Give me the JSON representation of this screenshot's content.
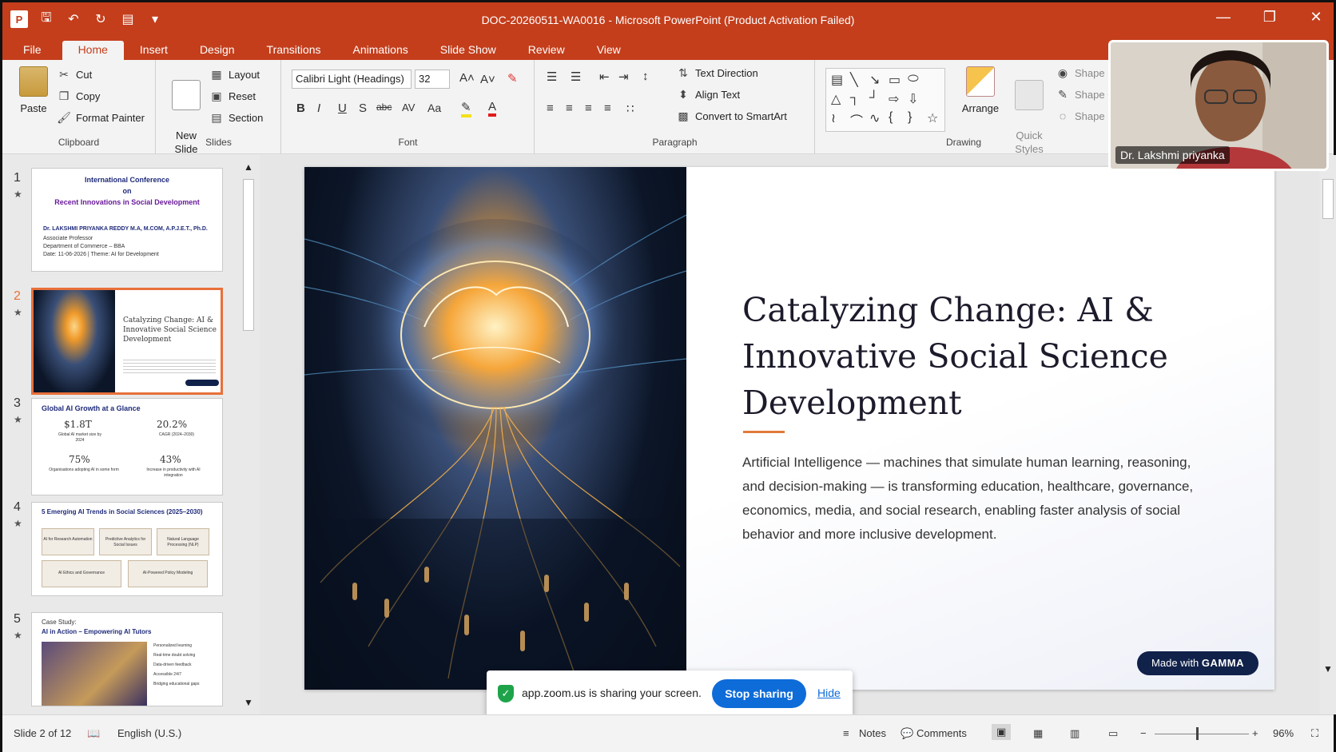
{
  "window": {
    "title": "DOC-20260511-WA0016  -  Microsoft PowerPoint (Product Activation Failed)",
    "app_logo": "P"
  },
  "tabs": [
    "File",
    "Home",
    "Insert",
    "Design",
    "Transitions",
    "Animations",
    "Slide Show",
    "Review",
    "View"
  ],
  "ribbon": {
    "clipboard": {
      "paste": "Paste",
      "cut": "Cut",
      "copy": "Copy",
      "format_painter": "Format Painter",
      "label": "Clipboard"
    },
    "slides": {
      "new_slide": "New\nSlide",
      "layout": "Layout",
      "reset": "Reset",
      "section": "Section",
      "label": "Slides"
    },
    "font": {
      "family": "Calibri Light (Headings)",
      "size": "32",
      "label": "Font"
    },
    "paragraph": {
      "text_direction": "Text Direction",
      "align_text": "Align Text",
      "convert_smartart": "Convert to SmartArt",
      "label": "Paragraph"
    },
    "drawing": {
      "arrange": "Arrange",
      "quick_styles": "Quick\nStyles",
      "shape_fill": "Shape Fill",
      "shape_outline": "Shape Out",
      "shape_effects": "Shape Effe",
      "label": "Drawing"
    }
  },
  "thumbnails": [
    {
      "num": "1",
      "lines": [
        "International Conference",
        "on",
        "Recent Innovations in Social Development",
        "Dr. LAKSHMI PRIYANKA REDDY M.A, M.COM, A.P.J.E.T., Ph.D.",
        "Associate Professor",
        "Department of Commerce – BBA",
        "Date: 11-06-2026  |  Theme: AI for Development"
      ]
    },
    {
      "num": "2",
      "lines": [
        "Catalyzing Change: AI & Innovative Social Science Development"
      ]
    },
    {
      "num": "3",
      "lines": [
        "Global AI Growth at a Glance",
        "$1.8T",
        "Global AI market size by 2024",
        "20.2%",
        "CAGR (2024–2030)",
        "75%",
        "Organisations adopting AI in some form",
        "43%",
        "Increase in productivity with AI integration"
      ]
    },
    {
      "num": "4",
      "lines": [
        "5 Emerging AI Trends in Social Sciences (2025–2030)",
        "AI for Research Automation",
        "Predictive Analytics for Social Issues",
        "Natural Language Processing (NLP)",
        "AI Ethics and Governance",
        "AI-Powered Policy Modeling"
      ]
    },
    {
      "num": "5",
      "lines": [
        "Case Study:",
        "AI in Action – Empowering AI Tutors",
        "Personalized learning",
        "Real-time doubt solving",
        "Data-driven feedback",
        "Accessible 24/7",
        "Bridging educational gaps"
      ]
    }
  ],
  "slide": {
    "title": "Catalyzing Change: AI & Innovative Social Science Development",
    "body": "Artificial Intelligence — machines that simulate human learning, reasoning, and decision-making — is transforming education, healthcare, governance, economics, media, and social research, enabling faster analysis of social behavior and more inclusive development.",
    "badge_prefix": "Made with ",
    "badge_brand": "GAMMA"
  },
  "video": {
    "name": "Dr. Lakshmi priyanka"
  },
  "share_bar": {
    "message": "app.zoom.us is sharing your screen.",
    "stop": "Stop sharing",
    "hide": "Hide"
  },
  "status": {
    "slide_counter": "Slide 2 of 12",
    "language": "English (U.S.)",
    "notes": "Notes",
    "comments": "Comments",
    "zoom": "96%"
  },
  "colors": {
    "accent": "#c43e1c",
    "selected_thumb": "#e8703a",
    "zoom_blue": "#0e6cd8"
  }
}
